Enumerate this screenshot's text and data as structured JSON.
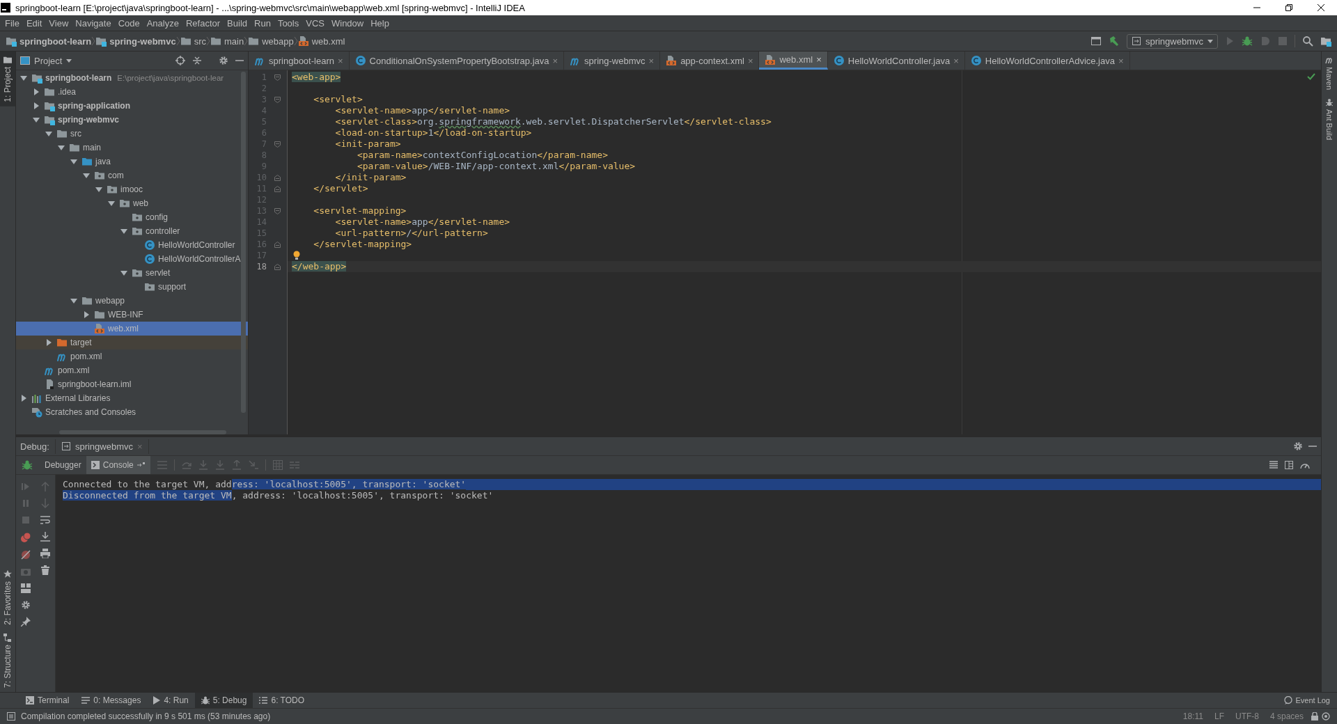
{
  "window": {
    "title": "springboot-learn [E:\\project\\java\\springboot-learn] - ...\\spring-webmvc\\src\\main\\webapp\\web.xml [spring-webmvc] - IntelliJ IDEA"
  },
  "menu": [
    "File",
    "Edit",
    "View",
    "Navigate",
    "Code",
    "Analyze",
    "Refactor",
    "Build",
    "Run",
    "Tools",
    "VCS",
    "Window",
    "Help"
  ],
  "breadcrumbs": [
    {
      "label": "springboot-learn",
      "kind": "module"
    },
    {
      "label": "spring-webmvc",
      "kind": "module"
    },
    {
      "label": "src",
      "kind": "folder"
    },
    {
      "label": "main",
      "kind": "folder"
    },
    {
      "label": "webapp",
      "kind": "folder"
    },
    {
      "label": "web.xml",
      "kind": "xml"
    }
  ],
  "run_config": "springwebmvc",
  "left_strip": {
    "top": [
      {
        "label": "1: Project",
        "selected": true
      }
    ],
    "bottom": [
      {
        "label": "2: Favorites",
        "selected": false,
        "kind": "favorites"
      },
      {
        "label": "7: Structure",
        "selected": false,
        "kind": "structure"
      }
    ]
  },
  "right_strip": [
    {
      "label": "Maven",
      "kind": "maven"
    },
    {
      "label": "Ant Build",
      "kind": "ant"
    }
  ],
  "project": {
    "title": "Project",
    "tree": [
      {
        "label": "springboot-learn",
        "path": "E:\\project\\java\\springboot-lear",
        "kind": "module",
        "expanded": true,
        "selected": false,
        "children": [
          {
            "label": ".idea",
            "kind": "folder",
            "expanded": false,
            "selected": false
          },
          {
            "label": "spring-application",
            "kind": "module",
            "expanded": false,
            "selected": false
          },
          {
            "label": "spring-webmvc",
            "kind": "module",
            "expanded": true,
            "selected": false,
            "children": [
              {
                "label": "src",
                "kind": "folder",
                "expanded": true,
                "selected": false,
                "children": [
                  {
                    "label": "main",
                    "kind": "folder",
                    "expanded": true,
                    "selected": false,
                    "children": [
                      {
                        "label": "java",
                        "kind": "source",
                        "expanded": true,
                        "selected": false,
                        "children": [
                          {
                            "label": "com",
                            "kind": "package",
                            "expanded": true,
                            "selected": false,
                            "children": [
                              {
                                "label": "imooc",
                                "kind": "package",
                                "expanded": true,
                                "selected": false,
                                "children": [
                                  {
                                    "label": "web",
                                    "kind": "package",
                                    "expanded": true,
                                    "selected": false,
                                    "children": [
                                      {
                                        "label": "config",
                                        "kind": "package",
                                        "selected": false
                                      },
                                      {
                                        "label": "controller",
                                        "kind": "package",
                                        "expanded": true,
                                        "selected": false,
                                        "children": [
                                          {
                                            "label": "HelloWorldController",
                                            "kind": "class",
                                            "selected": false
                                          },
                                          {
                                            "label": "HelloWorldControllerA",
                                            "kind": "class",
                                            "selected": false
                                          }
                                        ]
                                      },
                                      {
                                        "label": "servlet",
                                        "kind": "package",
                                        "expanded": true,
                                        "selected": false,
                                        "children": [
                                          {
                                            "label": "support",
                                            "kind": "package",
                                            "selected": false
                                          }
                                        ]
                                      }
                                    ]
                                  }
                                ]
                              }
                            ]
                          }
                        ]
                      },
                      {
                        "label": "webapp",
                        "kind": "folder",
                        "expanded": true,
                        "selected": false,
                        "children": [
                          {
                            "label": "WEB-INF",
                            "kind": "folder",
                            "expanded": false,
                            "selected": false
                          },
                          {
                            "label": "web.xml",
                            "kind": "xml",
                            "selected": true
                          }
                        ]
                      }
                    ]
                  }
                ]
              },
              {
                "label": "target",
                "kind": "excluded",
                "expanded": false,
                "selected": false
              },
              {
                "label": "pom.xml",
                "kind": "maven",
                "selected": false
              }
            ]
          },
          {
            "label": "pom.xml",
            "kind": "maven",
            "selected": false
          },
          {
            "label": "springboot-learn.iml",
            "kind": "iml",
            "selected": false
          }
        ]
      },
      {
        "label": "External Libraries",
        "kind": "libraries",
        "expanded": false,
        "selected": false
      },
      {
        "label": "Scratches and Consoles",
        "kind": "scratches",
        "selected": false
      }
    ]
  },
  "tabs": [
    {
      "label": "springboot-learn",
      "kind": "maven",
      "close": "×",
      "selected": false
    },
    {
      "label": "ConditionalOnSystemPropertyBootstrap.java",
      "kind": "class",
      "close": "×",
      "selected": false
    },
    {
      "label": "spring-webmvc",
      "kind": "maven",
      "close": "×",
      "selected": false
    },
    {
      "label": "app-context.xml",
      "kind": "xml",
      "close": "×",
      "selected": false
    },
    {
      "label": "web.xml",
      "kind": "xml",
      "close": "×",
      "selected": true
    },
    {
      "label": "HelloWorldController.java",
      "kind": "class",
      "close": "×",
      "selected": false
    },
    {
      "label": "HelloWorldControllerAdvice.java",
      "kind": "class",
      "close": "×",
      "selected": false
    }
  ],
  "editor": {
    "lines": [
      {
        "number": "1",
        "fold_start": true,
        "current": false,
        "segments": [
          {
            "text": "<web-app>",
            "kind": "tag-match"
          }
        ]
      },
      {
        "number": "2",
        "current": false
      },
      {
        "number": "3",
        "fold_start": true,
        "current": false,
        "segments": [
          {
            "text": "    <servlet>",
            "kind": "tag"
          }
        ]
      },
      {
        "number": "4",
        "current": false,
        "segments": [
          {
            "text": "        <servlet-name>",
            "kind": "tag"
          },
          {
            "text": "app",
            "kind": "text"
          },
          {
            "text": "</servlet-name>",
            "kind": "tag"
          }
        ]
      },
      {
        "number": "5",
        "current": false,
        "segments": [
          {
            "text": "        <servlet-class>",
            "kind": "tag"
          },
          {
            "text": "org.",
            "kind": "text"
          },
          {
            "text": "springframework",
            "kind": "text",
            "typo": true
          },
          {
            "text": ".web.servlet.DispatcherServlet",
            "kind": "text"
          },
          {
            "text": "</servlet-class>",
            "kind": "tag"
          }
        ]
      },
      {
        "number": "6",
        "current": false,
        "segments": [
          {
            "text": "        <load-on-startup>",
            "kind": "tag"
          },
          {
            "text": "1",
            "kind": "text"
          },
          {
            "text": "</load-on-startup>",
            "kind": "tag"
          }
        ]
      },
      {
        "number": "7",
        "fold_start": true,
        "current": false,
        "segments": [
          {
            "text": "        <init-param>",
            "kind": "tag"
          }
        ]
      },
      {
        "number": "8",
        "current": false,
        "segments": [
          {
            "text": "            <param-name>",
            "kind": "tag"
          },
          {
            "text": "contextConfigLocation",
            "kind": "text"
          },
          {
            "text": "</param-name>",
            "kind": "tag"
          }
        ]
      },
      {
        "number": "9",
        "current": false,
        "segments": [
          {
            "text": "            <param-value>",
            "kind": "tag"
          },
          {
            "text": "/WEB-INF/app-context.xml",
            "kind": "text"
          },
          {
            "text": "</param-value>",
            "kind": "tag"
          }
        ]
      },
      {
        "number": "10",
        "fold_end": true,
        "current": false,
        "segments": [
          {
            "text": "        </init-param>",
            "kind": "tag"
          }
        ]
      },
      {
        "number": "11",
        "fold_end": true,
        "current": false,
        "segments": [
          {
            "text": "    </servlet>",
            "kind": "tag"
          }
        ]
      },
      {
        "number": "12",
        "current": false
      },
      {
        "number": "13",
        "fold_start": true,
        "current": false,
        "segments": [
          {
            "text": "    <servlet-mapping>",
            "kind": "tag"
          }
        ]
      },
      {
        "number": "14",
        "current": false,
        "segments": [
          {
            "text": "        <servlet-name>",
            "kind": "tag"
          },
          {
            "text": "app",
            "kind": "text"
          },
          {
            "text": "</servlet-name>",
            "kind": "tag"
          }
        ]
      },
      {
        "number": "15",
        "current": false,
        "segments": [
          {
            "text": "        <url-pattern>",
            "kind": "tag"
          },
          {
            "text": "/",
            "kind": "text"
          },
          {
            "text": "</url-pattern>",
            "kind": "tag"
          }
        ]
      },
      {
        "number": "16",
        "fold_end": true,
        "current": false,
        "segments": [
          {
            "text": "    </servlet-mapping>",
            "kind": "tag"
          }
        ]
      },
      {
        "number": "17",
        "current": false,
        "bulb": true
      },
      {
        "number": "18",
        "fold_end": true,
        "current": true,
        "segments": [
          {
            "text": "</web-app>",
            "kind": "tag-match"
          }
        ]
      }
    ]
  },
  "debug": {
    "title": "Debug:",
    "session": {
      "label": "springwebmvc",
      "close": "×"
    },
    "tabs": [
      {
        "label": "Debugger",
        "selected": false
      },
      {
        "label": "Console",
        "selected": true
      }
    ],
    "console": [
      {
        "eol_selected": true,
        "segments": [
          {
            "text": "Connected to the target VM, add",
            "selected": false
          },
          {
            "text": "ress: 'localhost:5005', transport: 'socket'",
            "selected": true
          }
        ]
      },
      {
        "eol_selected": false,
        "segments": [
          {
            "text": "Disconnected from the target VM",
            "selected": true
          },
          {
            "text": ", address: 'localhost:5005', transport: 'socket'",
            "selected": false
          }
        ]
      }
    ]
  },
  "tool_windows": [
    {
      "label": "Terminal",
      "kind": "terminal",
      "selected": false
    },
    {
      "label": "0: Messages",
      "kind": "messages",
      "selected": false
    },
    {
      "label": "4: Run",
      "kind": "run",
      "selected": false
    },
    {
      "label": "5: Debug",
      "kind": "debug",
      "selected": true
    },
    {
      "label": "6: TODO",
      "kind": "todo",
      "selected": false
    }
  ],
  "event_log": "Event Log",
  "status": {
    "message": "Compilation completed successfully in 9 s 501 ms (53 minutes ago)",
    "items": [
      "18:11",
      "LF",
      "UTF-8",
      "4 spaces"
    ]
  }
}
